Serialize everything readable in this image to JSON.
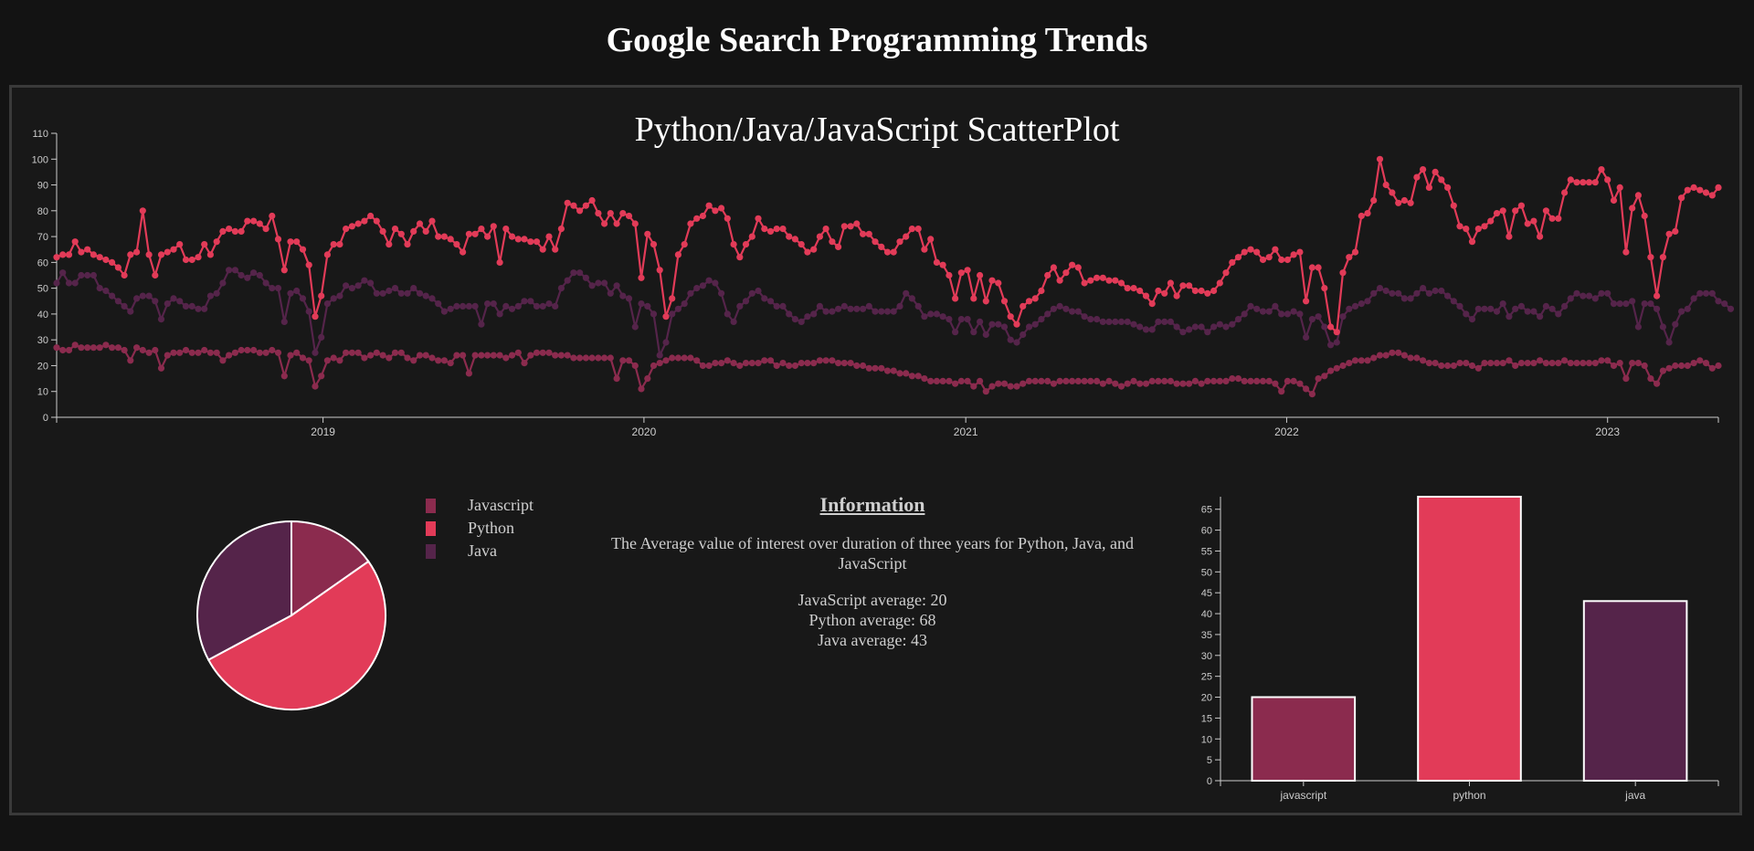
{
  "page": {
    "title": "Google Search Programming Trends"
  },
  "colors": {
    "javascript": "#8b2b4e",
    "python": "#e23b58",
    "java": "#55244a",
    "axis": "#cccccc",
    "background": "#181818"
  },
  "legend": [
    {
      "label": "Javascript",
      "color": "#8b2b4e"
    },
    {
      "label": "Python",
      "color": "#e23b58"
    },
    {
      "label": "Java",
      "color": "#55244a"
    }
  ],
  "info": {
    "heading": "Information",
    "description": "The Average value of interest over duration of three years for Python, Java, and JavaScript",
    "averages": [
      "JavaScript average: 20",
      "Python average: 68",
      "Java average: 43"
    ]
  },
  "chart_data": [
    {
      "type": "scatter",
      "title": "Python/Java/JavaScript ScatterPlot",
      "x_start": "2018-03-04",
      "x_interval": "weekly",
      "x_ticks": [
        "2019",
        "2020",
        "2021",
        "2022",
        "2023"
      ],
      "ylim": [
        0,
        110
      ],
      "y_ticks": [
        0,
        10,
        20,
        30,
        40,
        50,
        60,
        70,
        80,
        90,
        100,
        110
      ],
      "series": [
        {
          "name": "Python",
          "color": "#e23b58",
          "values": [
            62,
            63,
            63,
            68,
            64,
            65,
            63,
            62,
            61,
            60,
            58,
            55,
            63,
            64,
            80,
            63,
            55,
            63,
            64,
            65,
            67,
            61,
            61,
            62,
            67,
            63,
            68,
            72,
            73,
            72,
            72,
            76,
            76,
            75,
            73,
            78,
            69,
            57,
            68,
            68,
            65,
            59,
            39,
            47,
            63,
            67,
            67,
            73,
            74,
            75,
            76,
            78,
            76,
            72,
            67,
            73,
            71,
            67,
            72,
            75,
            72,
            76,
            70,
            70,
            69,
            67,
            64,
            71,
            71,
            73,
            70,
            74,
            60,
            73,
            70,
            69,
            69,
            68,
            68,
            65,
            70,
            65,
            73,
            83,
            82,
            80,
            82,
            84,
            79,
            75,
            79,
            75,
            79,
            78,
            75,
            54,
            71,
            67,
            57,
            39,
            46,
            63,
            67,
            75,
            77,
            78,
            82,
            80,
            81,
            77,
            67,
            62,
            67,
            70,
            77,
            73,
            72,
            73,
            73,
            70,
            69,
            67,
            64,
            65,
            70,
            73,
            68,
            66,
            74,
            74,
            75,
            71,
            71,
            68,
            66,
            64,
            64,
            68,
            70,
            73,
            73,
            65,
            69,
            60,
            59,
            55,
            46,
            56,
            57,
            46,
            55,
            45,
            53,
            52,
            45,
            39,
            36,
            43,
            45,
            46,
            49,
            55,
            58,
            53,
            56,
            59,
            58,
            52,
            53,
            54,
            54,
            53,
            53,
            52,
            50,
            50,
            49,
            47,
            44,
            49,
            48,
            52,
            47,
            51,
            51,
            49,
            49,
            48,
            49,
            52,
            56,
            60,
            62,
            64,
            65,
            64,
            61,
            62,
            65,
            61,
            61,
            63,
            64,
            45,
            58,
            58,
            50,
            35,
            33,
            56,
            62,
            64,
            78,
            79,
            84,
            100,
            90,
            87,
            83,
            84,
            83,
            93,
            96,
            89,
            95,
            92,
            89,
            82,
            74,
            73,
            68,
            73,
            74,
            76,
            79,
            80,
            70,
            80,
            82,
            75,
            76,
            70,
            80,
            77,
            77,
            87,
            92,
            91,
            91,
            91,
            91,
            96,
            92,
            84,
            89,
            64,
            81,
            86,
            78,
            62,
            47,
            62,
            71,
            72,
            85,
            88,
            89,
            88,
            87,
            86,
            89
          ]
        },
        {
          "name": "Java",
          "color": "#55244a",
          "values": [
            52,
            56,
            52,
            52,
            55,
            55,
            55,
            50,
            49,
            47,
            45,
            43,
            41,
            46,
            47,
            47,
            45,
            38,
            44,
            46,
            45,
            43,
            43,
            42,
            42,
            47,
            48,
            52,
            57,
            57,
            55,
            54,
            56,
            55,
            52,
            50,
            50,
            37,
            48,
            49,
            46,
            41,
            25,
            31,
            44,
            46,
            47,
            51,
            50,
            51,
            53,
            52,
            48,
            48,
            49,
            50,
            48,
            48,
            50,
            48,
            47,
            46,
            44,
            41,
            42,
            43,
            43,
            43,
            43,
            36,
            44,
            44,
            40,
            43,
            42,
            43,
            45,
            45,
            43,
            43,
            44,
            43,
            50,
            53,
            56,
            56,
            54,
            51,
            52,
            52,
            48,
            51,
            47,
            46,
            35,
            44,
            43,
            40,
            24,
            29,
            40,
            42,
            44,
            48,
            50,
            51,
            53,
            52,
            48,
            40,
            37,
            43,
            45,
            48,
            49,
            46,
            45,
            43,
            43,
            40,
            38,
            37,
            39,
            40,
            43,
            41,
            41,
            42,
            43,
            42,
            42,
            42,
            43,
            41,
            41,
            41,
            41,
            43,
            48,
            46,
            43,
            39,
            40,
            40,
            39,
            38,
            33,
            38,
            38,
            33,
            37,
            32,
            36,
            36,
            35,
            30,
            29,
            32,
            35,
            36,
            38,
            40,
            42,
            43,
            42,
            41,
            41,
            39,
            38,
            38,
            37,
            37,
            37,
            37,
            37,
            36,
            35,
            34,
            34,
            37,
            37,
            37,
            35,
            33,
            34,
            35,
            35,
            33,
            35,
            36,
            35,
            36,
            38,
            40,
            43,
            42,
            41,
            41,
            43,
            40,
            40,
            41,
            40,
            31,
            38,
            39,
            35,
            28,
            29,
            39,
            42,
            43,
            44,
            45,
            48,
            50,
            49,
            48,
            48,
            46,
            46,
            48,
            50,
            48,
            49,
            49,
            47,
            45,
            43,
            40,
            38,
            42,
            42,
            42,
            41,
            44,
            39,
            42,
            43,
            41,
            41,
            39,
            43,
            42,
            40,
            43,
            46,
            48,
            47,
            47,
            46,
            48,
            48,
            44,
            44,
            44,
            45,
            35,
            44,
            44,
            42,
            35,
            29,
            36,
            41,
            42,
            46,
            48,
            48,
            48,
            45,
            44,
            42
          ]
        },
        {
          "name": "Javascript",
          "color": "#8b2b4e",
          "values": [
            27,
            26,
            26,
            28,
            27,
            27,
            27,
            27,
            28,
            27,
            27,
            26,
            22,
            27,
            26,
            25,
            26,
            19,
            24,
            25,
            25,
            26,
            25,
            25,
            26,
            25,
            25,
            22,
            24,
            25,
            26,
            26,
            26,
            25,
            25,
            26,
            25,
            16,
            24,
            25,
            23,
            22,
            12,
            16,
            22,
            23,
            22,
            25,
            25,
            25,
            23,
            24,
            25,
            24,
            23,
            25,
            25,
            23,
            22,
            24,
            24,
            23,
            22,
            22,
            21,
            24,
            24,
            17,
            24,
            24,
            24,
            24,
            24,
            23,
            24,
            25,
            21,
            24,
            25,
            25,
            25,
            24,
            24,
            24,
            23,
            23,
            23,
            23,
            23,
            23,
            23,
            15,
            22,
            22,
            20,
            11,
            15,
            20,
            21,
            22,
            23,
            23,
            23,
            23,
            22,
            20,
            20,
            21,
            21,
            22,
            21,
            20,
            21,
            21,
            21,
            22,
            22,
            20,
            21,
            20,
            20,
            21,
            21,
            21,
            22,
            22,
            22,
            21,
            21,
            21,
            20,
            20,
            19,
            19,
            19,
            18,
            18,
            17,
            17,
            16,
            16,
            15,
            14,
            14,
            14,
            14,
            13,
            14,
            14,
            12,
            14,
            10,
            12,
            13,
            13,
            12,
            12,
            13,
            14,
            14,
            14,
            14,
            13,
            14,
            14,
            14,
            14,
            14,
            14,
            14,
            13,
            14,
            13,
            12,
            13,
            14,
            13,
            13,
            14,
            14,
            14,
            14,
            13,
            13,
            13,
            14,
            13,
            14,
            14,
            14,
            14,
            15,
            15,
            14,
            14,
            14,
            14,
            14,
            13,
            10,
            14,
            14,
            13,
            11,
            9,
            15,
            16,
            18,
            19,
            20,
            21,
            22,
            22,
            22,
            23,
            24,
            24,
            25,
            25,
            24,
            23,
            23,
            22,
            21,
            21,
            20,
            20,
            20,
            21,
            21,
            20,
            19,
            21,
            21,
            21,
            21,
            22,
            20,
            21,
            21,
            21,
            22,
            21,
            21,
            21,
            22,
            21,
            21,
            21,
            21,
            21,
            22,
            22,
            20,
            21,
            15,
            21,
            21,
            20,
            15,
            13,
            18,
            19,
            20,
            20,
            20,
            21,
            22,
            21,
            19,
            20
          ]
        }
      ]
    },
    {
      "type": "pie",
      "slices": [
        {
          "name": "javascript",
          "value": 20,
          "color": "#8b2b4e"
        },
        {
          "name": "python",
          "value": 68,
          "color": "#e23b58"
        },
        {
          "name": "java",
          "value": 43,
          "color": "#55244a"
        }
      ]
    },
    {
      "type": "bar",
      "categories": [
        "javascript",
        "python",
        "java"
      ],
      "values": [
        20,
        68,
        43
      ],
      "colors": [
        "#8b2b4e",
        "#e23b58",
        "#55244a"
      ],
      "ylim": [
        0,
        68
      ],
      "y_ticks": [
        0,
        5,
        10,
        15,
        20,
        25,
        30,
        35,
        40,
        45,
        50,
        55,
        60,
        65
      ]
    }
  ]
}
